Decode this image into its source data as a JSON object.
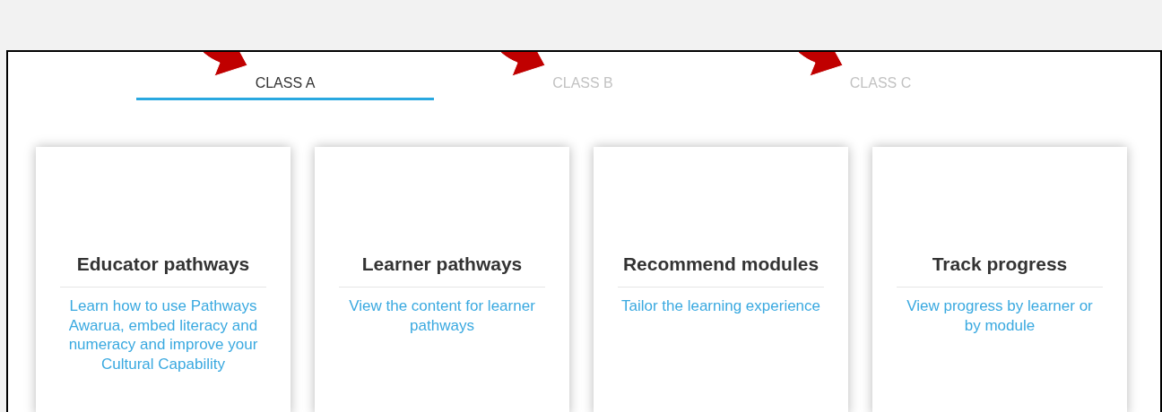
{
  "tabs": [
    {
      "label": "CLASS A",
      "selected": true,
      "annotated": true
    },
    {
      "label": "CLASS B",
      "selected": false,
      "annotated": true
    },
    {
      "label": "CLASS C",
      "selected": false,
      "annotated": true
    }
  ],
  "cards": [
    {
      "title": "Educator pathways",
      "description": "Learn how to use Pathways Awarua, embed literacy and numeracy and improve your Cultural Capability"
    },
    {
      "title": "Learner pathways",
      "description": "View the content for learner pathways"
    },
    {
      "title": "Recommend modules",
      "description": "Tailor the learning experience"
    },
    {
      "title": "Track progress",
      "description": "View progress by learner or by module"
    }
  ]
}
